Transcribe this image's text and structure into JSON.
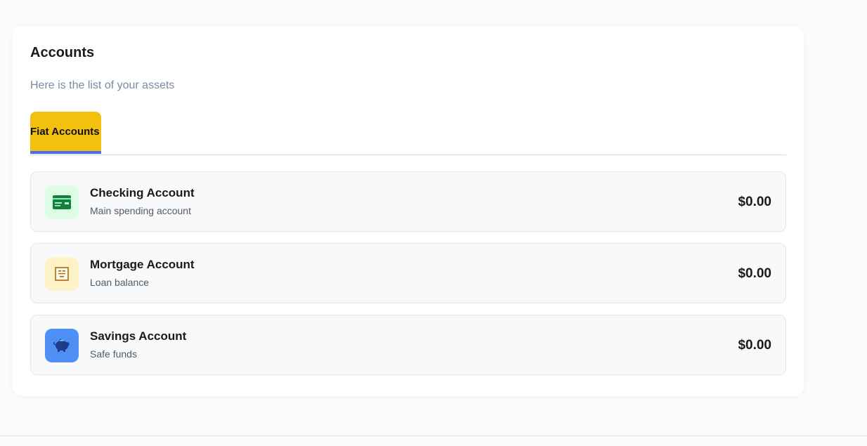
{
  "accounts_card": {
    "title": "Accounts",
    "subtitle": "Here is the list of your assets"
  },
  "tabs": [
    {
      "label": "Fiat Accounts",
      "active": true
    }
  ],
  "accounts": [
    {
      "name": "Checking Account",
      "description": "Main spending account",
      "balance": "$0.00",
      "icon": "credit-card-icon",
      "icon_bg": "#dcfce7",
      "icon_color": "#15803d"
    },
    {
      "name": "Mortgage Account",
      "description": "Loan balance",
      "balance": "$0.00",
      "icon": "id-card-icon",
      "icon_bg": "#fef3c7",
      "icon_color": "#a16207"
    },
    {
      "name": "Savings Account",
      "description": "Safe funds",
      "balance": "$0.00",
      "icon": "piggy-bank-icon",
      "icon_bg": "#4d8ff5",
      "icon_color": "#1e3a8a"
    }
  ],
  "colors": {
    "tab_active_bg": "#f4c00e",
    "tab_active_underline": "#4a6cf2",
    "subtitle": "#7a8aa3"
  }
}
